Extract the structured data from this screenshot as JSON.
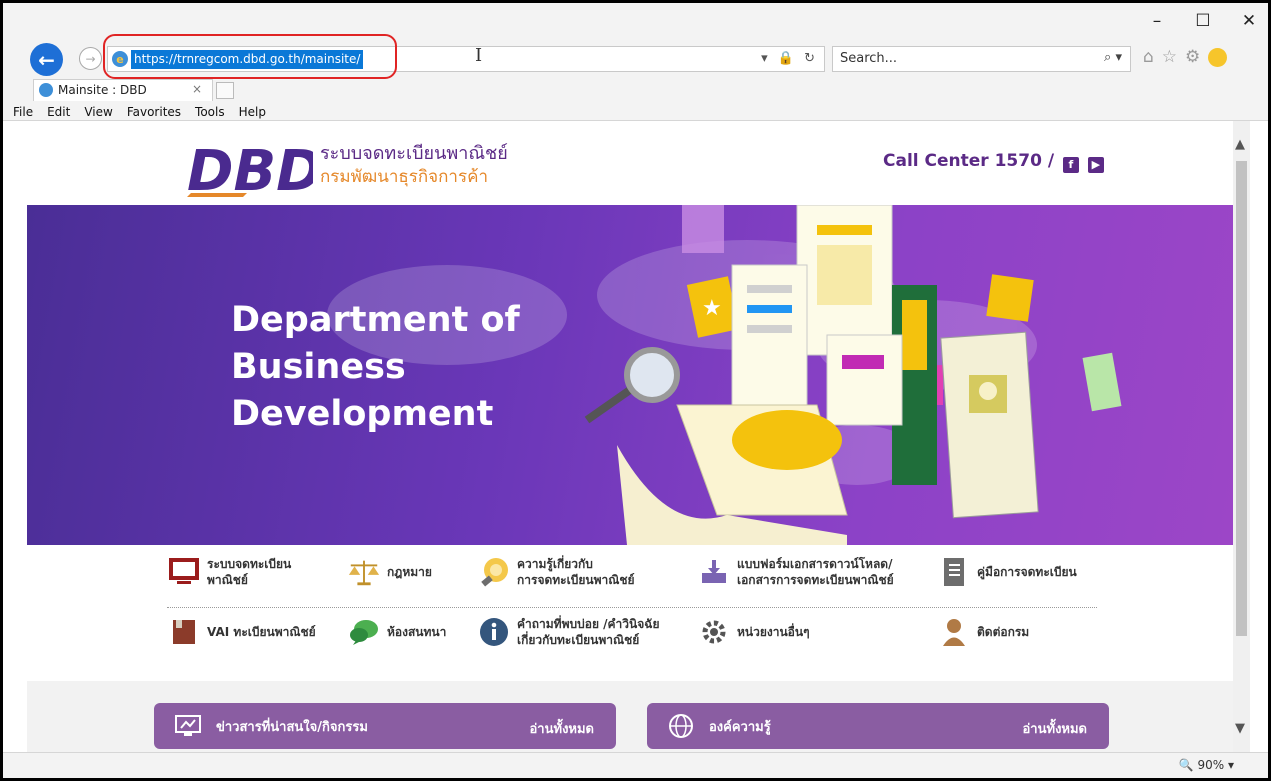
{
  "browser": {
    "url": "https://trnregcom.dbd.go.th/mainsite/",
    "search_placeholder": "Search...",
    "tab_title": "Mainsite : DBD",
    "tab_close": "×",
    "menu": [
      "File",
      "Edit",
      "View",
      "Favorites",
      "Tools",
      "Help"
    ],
    "zoom": "90%",
    "window_controls": {
      "minimize": "–",
      "maximize": "☐",
      "close": "✕"
    }
  },
  "header": {
    "logo": "DBD",
    "title_th": "ระบบจดทะเบียนพาณิชย์",
    "subtitle_th": "กรมพัฒนาธุรกิจการค้า",
    "call_center": "Call Center 1570 /",
    "facebook": "f",
    "youtube": "▶"
  },
  "hero": {
    "line1": "Department of",
    "line2": "Business",
    "line3": "Development"
  },
  "quick_links": {
    "row1": [
      {
        "l1": "ระบบจดทะเบียน",
        "l2": "พาณิชย์",
        "icon": "monitor-icon"
      },
      {
        "l1": "กฎหมาย",
        "l2": "",
        "icon": "scales-icon"
      },
      {
        "l1": "ความรู้เกี่ยวกับ",
        "l2": "การจดทะเบียนพาณิชย์",
        "icon": "lightbulb-icon"
      },
      {
        "l1": "แบบฟอร์มเอกสารดาวน์โหลด/",
        "l2": "เอกสารการจดทะเบียนพาณิชย์",
        "icon": "download-tray-icon"
      },
      {
        "l1": "คู่มือการจดทะเบียน",
        "l2": "",
        "icon": "manual-book-icon"
      }
    ],
    "row2": [
      {
        "l1": "VAI ทะเบียนพาณิชย์",
        "l2": "",
        "icon": "folder-icon"
      },
      {
        "l1": "ห้องสนทนา",
        "l2": "",
        "icon": "chat-bubble-icon"
      },
      {
        "l1": "คำถามที่พบบ่อย /คำวินิจฉัย",
        "l2": "เกี่ยวกับทะเบียนพาณิชย์",
        "icon": "info-icon"
      },
      {
        "l1": "หน่วยงานอื่นๆ",
        "l2": "",
        "icon": "gear-icon"
      },
      {
        "l1": "ติดต่อกรม",
        "l2": "",
        "icon": "person-icon"
      }
    ]
  },
  "bottom": {
    "news_label": "ข่าวสารที่น่าสนใจ/กิจกรรม",
    "news_readall": "อ่านทั้งหมด",
    "knowledge_label": "องค์ความรู้",
    "knowledge_readall": "อ่านทั้งหมด"
  },
  "colors": {
    "brand_purple": "#5b2a86",
    "brand_orange": "#e5882a",
    "button_purple": "#8a5da2",
    "highlight_red": "#e02424"
  }
}
